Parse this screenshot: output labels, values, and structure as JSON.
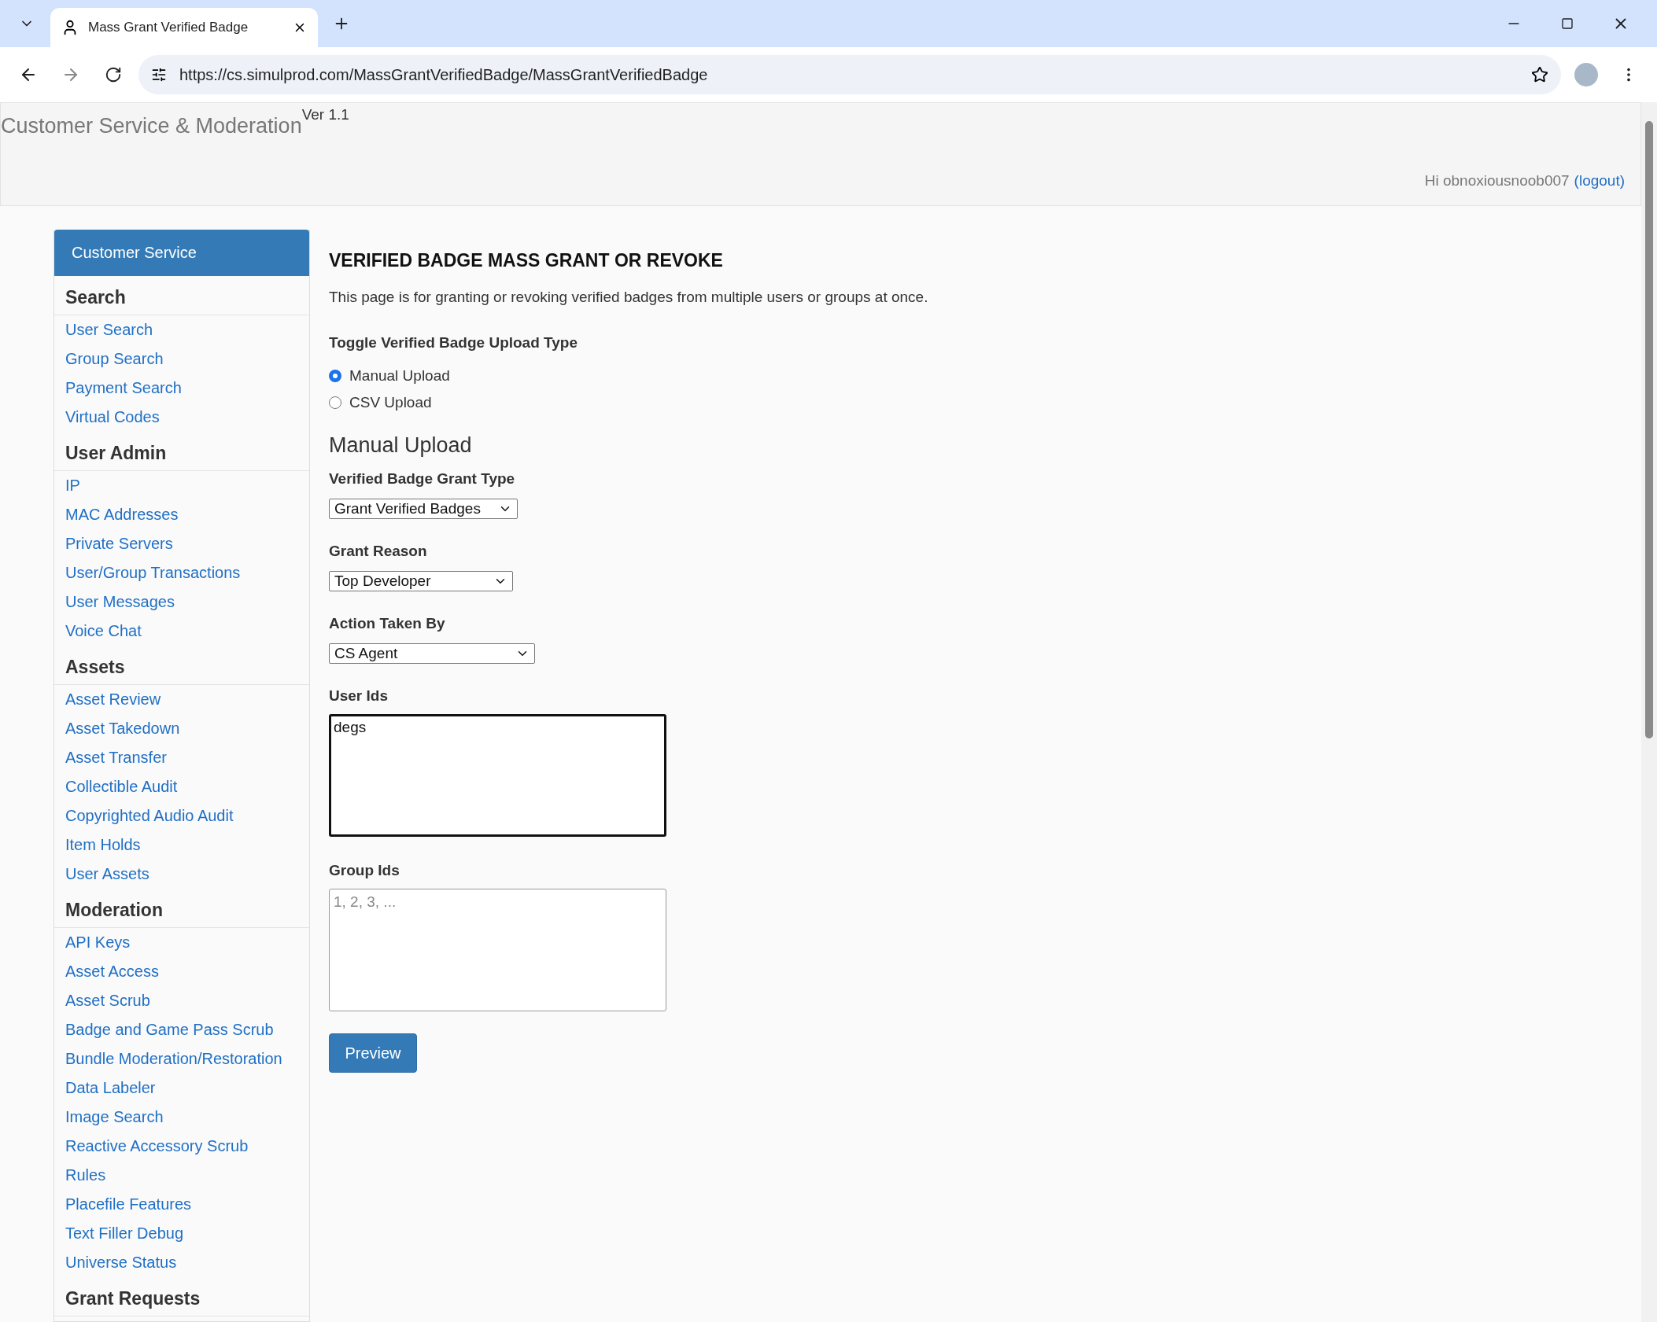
{
  "browser": {
    "tab_title": "Mass Grant Verified Badge",
    "url": "https://cs.simulprod.com/MassGrantVerifiedBadge/MassGrantVerifiedBadge"
  },
  "header": {
    "title": "Customer Service & Moderation",
    "version": "Ver 1.1",
    "greeting": "Hi obnoxiousnoob007",
    "logout": "(logout)"
  },
  "sidebar": {
    "title": "Customer Service",
    "sections": [
      {
        "heading": "Search",
        "links": [
          "User Search",
          "Group Search",
          "Payment Search",
          "Virtual Codes"
        ]
      },
      {
        "heading": "User Admin",
        "links": [
          "IP",
          "MAC Addresses",
          "Private Servers",
          "User/Group Transactions",
          "User Messages",
          "Voice Chat"
        ]
      },
      {
        "heading": "Assets",
        "links": [
          "Asset Review",
          "Asset Takedown",
          "Asset Transfer",
          "Collectible Audit",
          "Copyrighted Audio Audit",
          "Item Holds",
          "User Assets"
        ]
      },
      {
        "heading": "Moderation",
        "links": [
          "API Keys",
          "Asset Access",
          "Asset Scrub",
          "Badge and Game Pass Scrub",
          "Bundle Moderation/Restoration",
          "Data Labeler",
          "Image Search",
          "Reactive Accessory Scrub",
          "Rules",
          "Placefile Features",
          "Text Filler Debug",
          "Universe Status"
        ]
      },
      {
        "heading": "Grant Requests"
      }
    ]
  },
  "content": {
    "title": "VERIFIED BADGE MASS GRANT OR REVOKE",
    "description": "This page is for granting or revoking verified badges from multiple users or groups at once.",
    "toggle_label": "Toggle Verified Badge Upload Type",
    "upload_types": [
      {
        "label": "Manual Upload",
        "selected": true
      },
      {
        "label": "CSV Upload",
        "selected": false
      }
    ],
    "section_title": "Manual Upload",
    "fields": [
      {
        "kind": "select",
        "label": "Verified Badge Grant Type",
        "value": "Grant Verified Badges"
      },
      {
        "kind": "select",
        "label": "Grant Reason",
        "value": "Top Developer"
      },
      {
        "kind": "select",
        "label": "Action Taken By",
        "value": "CS Agent"
      },
      {
        "kind": "textarea",
        "label": "User Ids",
        "value": "degs",
        "focused": true
      },
      {
        "kind": "textarea",
        "label": "Group Ids",
        "placeholder": "1, 2, 3, ...",
        "focused": false
      }
    ],
    "button": "Preview"
  }
}
